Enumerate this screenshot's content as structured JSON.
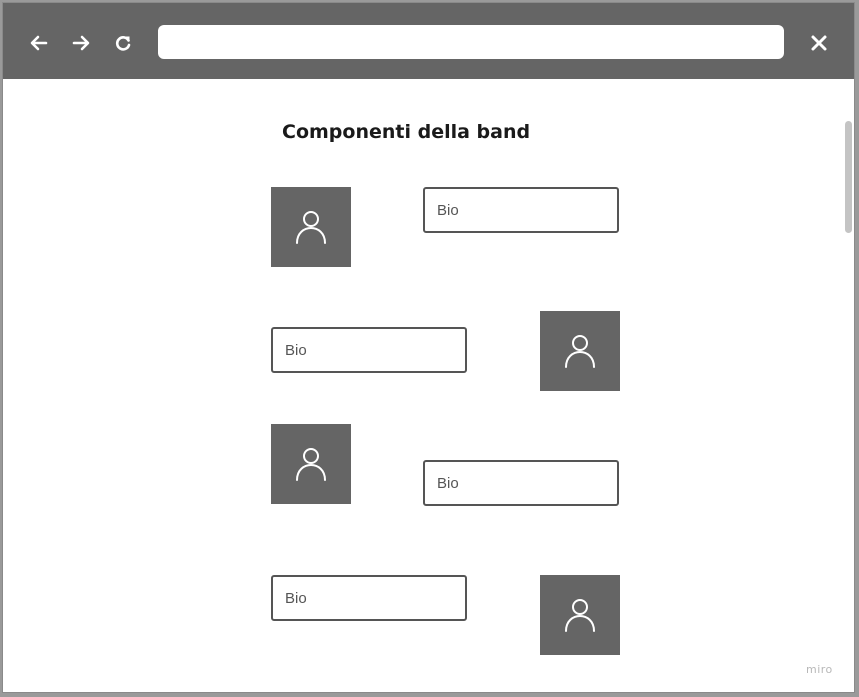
{
  "browser": {
    "back_icon": "arrow-left-icon",
    "forward_icon": "arrow-right-icon",
    "reload_icon": "reload-icon",
    "close_icon": "close-icon",
    "url_value": "",
    "toolbar_color": "#656565"
  },
  "page": {
    "title": "Componenti della band",
    "members": [
      {
        "avatar_icon": "user-icon",
        "bio_placeholder": "Bio"
      },
      {
        "avatar_icon": "user-icon",
        "bio_placeholder": "Bio"
      },
      {
        "avatar_icon": "user-icon",
        "bio_placeholder": "Bio"
      },
      {
        "avatar_icon": "user-icon",
        "bio_placeholder": "Bio"
      }
    ]
  },
  "watermark": "miro"
}
